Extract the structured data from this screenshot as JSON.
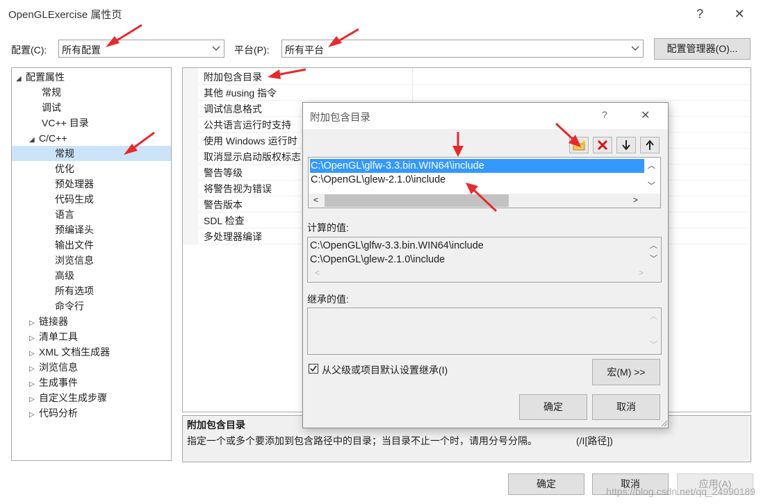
{
  "window": {
    "title": "OpenGLExercise 属性页",
    "help": "?",
    "close": "✕"
  },
  "top": {
    "config_label": "配置(C):",
    "config_value": "所有配置",
    "platform_label": "平台(P):",
    "platform_value": "所有平台",
    "config_manager": "配置管理器(O)..."
  },
  "tree": {
    "root": "配置属性",
    "general": "常规",
    "debug": "调试",
    "vcpp_dirs": "VC++ 目录",
    "cpp": "C/C++",
    "cpp_children": [
      "常规",
      "优化",
      "预处理器",
      "代码生成",
      "语言",
      "预编译头",
      "输出文件",
      "浏览信息",
      "高级",
      "所有选项",
      "命令行"
    ],
    "collapsed": [
      "链接器",
      "清单工具",
      "XML 文档生成器",
      "浏览信息",
      "生成事件",
      "自定义生成步骤",
      "代码分析"
    ]
  },
  "props": [
    "附加包含目录",
    "其他 #using 指令",
    "调试信息格式",
    "公共语言运行时支持",
    "使用 Windows 运行时",
    "取消显示启动版权标志",
    "警告等级",
    "将警告视为错误",
    "警告版本",
    "SDL 检查",
    "多处理器编译"
  ],
  "description": {
    "title": "附加包含目录",
    "text": "指定一个或多个要添加到包含路径中的目录；当目录不止一个时，请用分号分隔。",
    "switch": "(/I[路径])"
  },
  "dialog": {
    "title": "附加包含目录",
    "help": "?",
    "close": "✕",
    "entries": [
      "C:\\OpenGL\\glfw-3.3.bin.WIN64\\include",
      "C:\\OpenGL\\glew-2.1.0\\include"
    ],
    "computed_label": "计算的值:",
    "computed": [
      "C:\\OpenGL\\glfw-3.3.bin.WIN64\\include",
      "C:\\OpenGL\\glew-2.1.0\\include"
    ],
    "inherited_label": "继承的值:",
    "inherit_checkbox": "从父级或项目默认设置继承(I)",
    "macro_button": "宏(M) >>",
    "ok": "确定",
    "cancel": "取消"
  },
  "bottom": {
    "ok": "确定",
    "cancel": "取消",
    "apply": "应用(A)"
  },
  "watermark": "https://blog.csdn.net/qq_24990189",
  "colors": {
    "selection": "#3399ff",
    "tree_selected": "#cce4f7",
    "annotation_arrow": "#e8282b"
  }
}
